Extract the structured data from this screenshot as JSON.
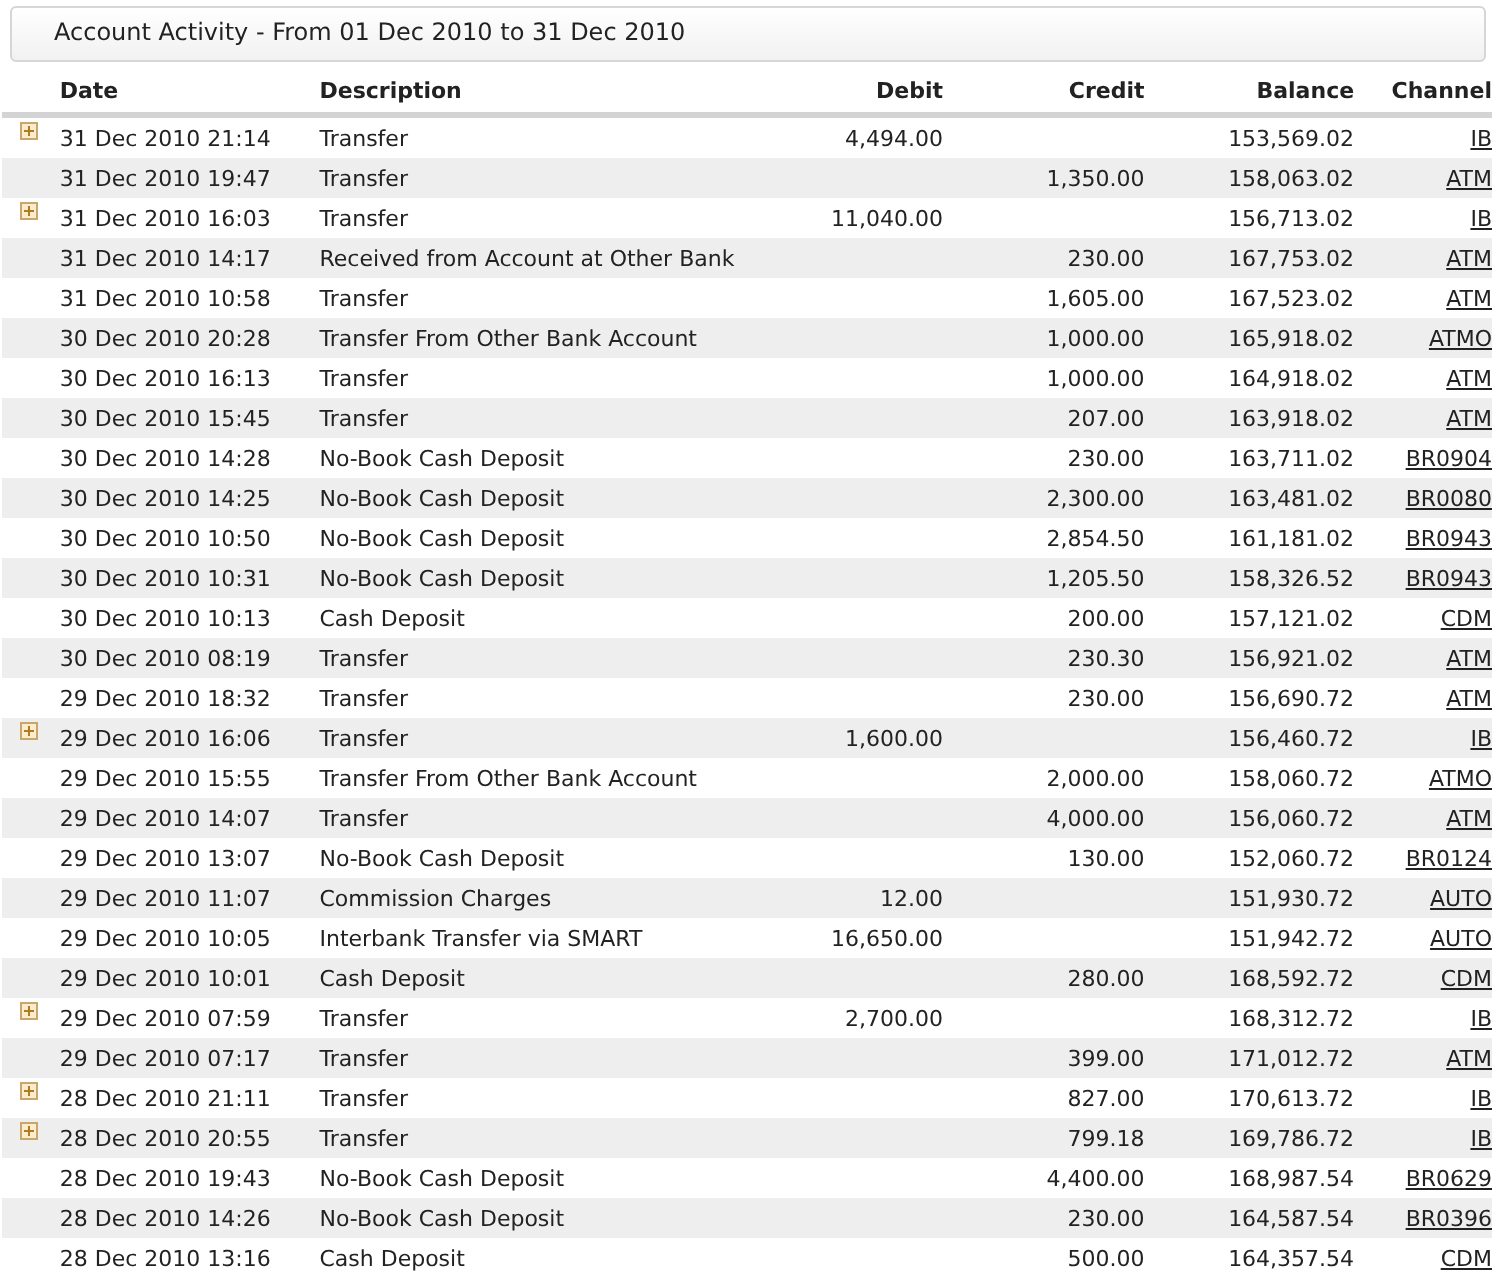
{
  "title": "Account Activity - From 01 Dec 2010 to 31 Dec 2010",
  "columns": [
    "Date",
    "Description",
    "Debit",
    "Credit",
    "Balance",
    "Channel"
  ],
  "rows": [
    {
      "expandable": true,
      "date": "31 Dec 2010 21:14",
      "description": "Transfer",
      "debit": "4,494.00",
      "credit": "",
      "balance": "153,569.02",
      "channel": "IB"
    },
    {
      "expandable": false,
      "date": "31 Dec 2010 19:47",
      "description": "Transfer",
      "debit": "",
      "credit": "1,350.00",
      "balance": "158,063.02",
      "channel": "ATM"
    },
    {
      "expandable": true,
      "date": "31 Dec 2010 16:03",
      "description": "Transfer",
      "debit": "11,040.00",
      "credit": "",
      "balance": "156,713.02",
      "channel": "IB"
    },
    {
      "expandable": false,
      "date": "31 Dec 2010 14:17",
      "description": "Received from Account at Other Bank",
      "debit": "",
      "credit": "230.00",
      "balance": "167,753.02",
      "channel": "ATM"
    },
    {
      "expandable": false,
      "date": "31 Dec 2010 10:58",
      "description": "Transfer",
      "debit": "",
      "credit": "1,605.00",
      "balance": "167,523.02",
      "channel": "ATM"
    },
    {
      "expandable": false,
      "date": "30 Dec 2010 20:28",
      "description": "Transfer From Other Bank Account",
      "debit": "",
      "credit": "1,000.00",
      "balance": "165,918.02",
      "channel": "ATMO"
    },
    {
      "expandable": false,
      "date": "30 Dec 2010 16:13",
      "description": "Transfer",
      "debit": "",
      "credit": "1,000.00",
      "balance": "164,918.02",
      "channel": "ATM"
    },
    {
      "expandable": false,
      "date": "30 Dec 2010 15:45",
      "description": "Transfer",
      "debit": "",
      "credit": "207.00",
      "balance": "163,918.02",
      "channel": "ATM"
    },
    {
      "expandable": false,
      "date": "30 Dec 2010 14:28",
      "description": "No-Book Cash Deposit",
      "debit": "",
      "credit": "230.00",
      "balance": "163,711.02",
      "channel": "BR0904"
    },
    {
      "expandable": false,
      "date": "30 Dec 2010 14:25",
      "description": "No-Book Cash Deposit",
      "debit": "",
      "credit": "2,300.00",
      "balance": "163,481.02",
      "channel": "BR0080"
    },
    {
      "expandable": false,
      "date": "30 Dec 2010 10:50",
      "description": "No-Book Cash Deposit",
      "debit": "",
      "credit": "2,854.50",
      "balance": "161,181.02",
      "channel": "BR0943"
    },
    {
      "expandable": false,
      "date": "30 Dec 2010 10:31",
      "description": "No-Book Cash Deposit",
      "debit": "",
      "credit": "1,205.50",
      "balance": "158,326.52",
      "channel": "BR0943"
    },
    {
      "expandable": false,
      "date": "30 Dec 2010 10:13",
      "description": "Cash Deposit",
      "debit": "",
      "credit": "200.00",
      "balance": "157,121.02",
      "channel": "CDM"
    },
    {
      "expandable": false,
      "date": "30 Dec 2010 08:19",
      "description": "Transfer",
      "debit": "",
      "credit": "230.30",
      "balance": "156,921.02",
      "channel": "ATM"
    },
    {
      "expandable": false,
      "date": "29 Dec 2010 18:32",
      "description": "Transfer",
      "debit": "",
      "credit": "230.00",
      "balance": "156,690.72",
      "channel": "ATM"
    },
    {
      "expandable": true,
      "date": "29 Dec 2010 16:06",
      "description": "Transfer",
      "debit": "1,600.00",
      "credit": "",
      "balance": "156,460.72",
      "channel": "IB"
    },
    {
      "expandable": false,
      "date": "29 Dec 2010 15:55",
      "description": "Transfer From Other Bank Account",
      "debit": "",
      "credit": "2,000.00",
      "balance": "158,060.72",
      "channel": "ATMO"
    },
    {
      "expandable": false,
      "date": "29 Dec 2010 14:07",
      "description": "Transfer",
      "debit": "",
      "credit": "4,000.00",
      "balance": "156,060.72",
      "channel": "ATM"
    },
    {
      "expandable": false,
      "date": "29 Dec 2010 13:07",
      "description": "No-Book Cash Deposit",
      "debit": "",
      "credit": "130.00",
      "balance": "152,060.72",
      "channel": "BR0124"
    },
    {
      "expandable": false,
      "date": "29 Dec 2010 11:07",
      "description": "Commission Charges",
      "debit": "12.00",
      "credit": "",
      "balance": "151,930.72",
      "channel": "AUTO"
    },
    {
      "expandable": false,
      "date": "29 Dec 2010 10:05",
      "description": "Interbank Transfer via SMART",
      "debit": "16,650.00",
      "credit": "",
      "balance": "151,942.72",
      "channel": "AUTO"
    },
    {
      "expandable": false,
      "date": "29 Dec 2010 10:01",
      "description": "Cash Deposit",
      "debit": "",
      "credit": "280.00",
      "balance": "168,592.72",
      "channel": "CDM"
    },
    {
      "expandable": true,
      "date": "29 Dec 2010 07:59",
      "description": "Transfer",
      "debit": "2,700.00",
      "credit": "",
      "balance": "168,312.72",
      "channel": "IB"
    },
    {
      "expandable": false,
      "date": "29 Dec 2010 07:17",
      "description": "Transfer",
      "debit": "",
      "credit": "399.00",
      "balance": "171,012.72",
      "channel": "ATM"
    },
    {
      "expandable": true,
      "date": "28 Dec 2010 21:11",
      "description": "Transfer",
      "debit": "",
      "credit": "827.00",
      "balance": "170,613.72",
      "channel": "IB"
    },
    {
      "expandable": true,
      "date": "28 Dec 2010 20:55",
      "description": "Transfer",
      "debit": "",
      "credit": "799.18",
      "balance": "169,786.72",
      "channel": "IB"
    },
    {
      "expandable": false,
      "date": "28 Dec 2010 19:43",
      "description": "No-Book Cash Deposit",
      "debit": "",
      "credit": "4,400.00",
      "balance": "168,987.54",
      "channel": "BR0629"
    },
    {
      "expandable": false,
      "date": "28 Dec 2010 14:26",
      "description": "No-Book Cash Deposit",
      "debit": "",
      "credit": "230.00",
      "balance": "164,587.54",
      "channel": "BR0396"
    },
    {
      "expandable": false,
      "date": "28 Dec 2010 13:16",
      "description": "Cash Deposit",
      "debit": "",
      "credit": "500.00",
      "balance": "164,357.54",
      "channel": "CDM"
    }
  ]
}
